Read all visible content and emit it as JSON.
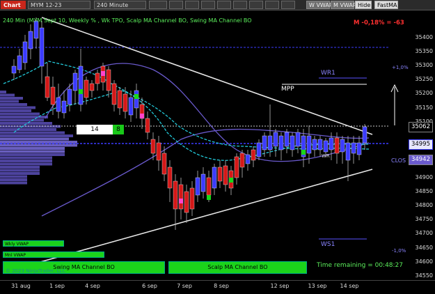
{
  "toolbar": {
    "chart_tab": "Chart",
    "instrument": "MYM 12-23",
    "interval": "240 Minute",
    "buttons": [
      "",
      "",
      "",
      "",
      "",
      "",
      ""
    ],
    "w_vwap": "W VWAP",
    "m_vwap": "M VWAP",
    "hide": "Hide",
    "fastma": "FastMA"
  },
  "header": {
    "title": "240 Min (MYM Sept 10, Weekly % , Wk TPO, Scalp MA Channel BO, Swing MA Channel BO",
    "pnl": "M -0,18% = -63"
  },
  "levels": {
    "wr1": "WR1",
    "ws1": "WS1",
    "mpp": "MPP",
    "plus_pct": "+1,0%",
    "minus_pct": "-1,0%",
    "clos": "CLOS",
    "wr": "WR"
  },
  "last_box": {
    "left": "14",
    "right": "8"
  },
  "price_tags": {
    "p1": "35062",
    "p2": "34995",
    "p3": "34942"
  },
  "yaxis": [
    "35400",
    "35350",
    "35300",
    "35250",
    "35200",
    "35150",
    "35100",
    "35050",
    "35000",
    "34950",
    "34900",
    "34850",
    "34800",
    "34750",
    "34700",
    "34650",
    "34600",
    "34550"
  ],
  "xaxis": [
    "31 aug",
    "1 sep",
    "4 sep",
    "6 sep",
    "7 sep",
    "8 sep",
    "12 sep",
    "13 sep",
    "14 sep"
  ],
  "buttons": {
    "wkly_vwap": "Wkly VWAP",
    "mnl_vwap": "Mnl VWAP",
    "swing_ma": "Swing MA Channel BO",
    "scalp_ma": "Scalp MA Channel BO"
  },
  "time_remaining": "Time remaining = 00:48:27",
  "copyright": "© 2023 NinjaTrader, LLC",
  "colors": {
    "up_candle": "#3b3bff",
    "down_candle": "#e01818",
    "channel": "#22c8d8",
    "mid_band": "#6a5acd",
    "green_btn": "#1bd31b"
  }
}
